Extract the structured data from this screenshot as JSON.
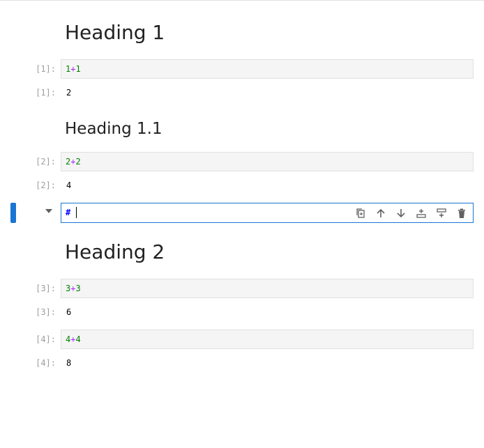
{
  "cells": [
    {
      "type": "markdown",
      "text": "Heading 1"
    },
    {
      "type": "code",
      "prompt_in": "[1]:",
      "code": {
        "a": "1",
        "op": "+",
        "b": "1"
      },
      "prompt_out": "[1]:",
      "output": "2"
    },
    {
      "type": "markdown",
      "text": "Heading 1.1"
    },
    {
      "type": "code",
      "prompt_in": "[2]:",
      "code": {
        "a": "2",
        "op": "+",
        "b": "2"
      },
      "prompt_out": "[2]:",
      "output": "4"
    },
    {
      "type": "markdown-editing",
      "source": "#"
    },
    {
      "type": "markdown",
      "text": "Heading 2"
    },
    {
      "type": "code",
      "prompt_in": "[3]:",
      "code": {
        "a": "3",
        "op": "+",
        "b": "3"
      },
      "prompt_out": "[3]:",
      "output": "6"
    },
    {
      "type": "code",
      "prompt_in": "[4]:",
      "code": {
        "a": "4",
        "op": "+",
        "b": "4"
      },
      "prompt_out": "[4]:",
      "output": "8"
    }
  ],
  "toolbar": {
    "icons": [
      "duplicate-icon",
      "move-up-icon",
      "move-down-icon",
      "insert-above-icon",
      "insert-below-icon",
      "delete-icon"
    ]
  },
  "colors": {
    "accent": "#1976d2",
    "number": "#008000",
    "operator": "#aa22ff",
    "prompt": "#9e9e9e"
  }
}
